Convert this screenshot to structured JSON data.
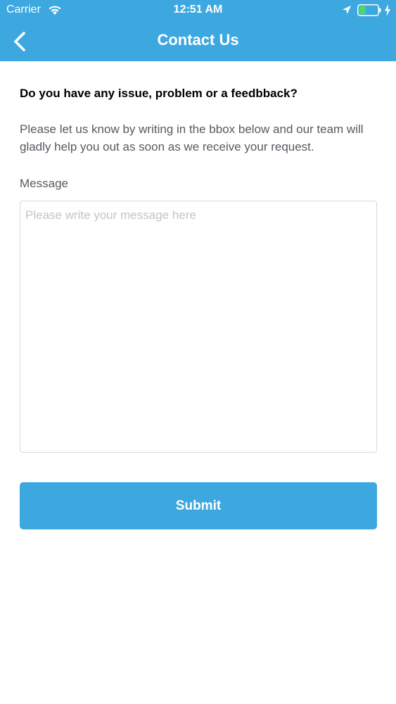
{
  "status_bar": {
    "carrier": "Carrier",
    "time": "12:51 AM",
    "icons": [
      "wifi-icon",
      "location-icon",
      "battery-icon",
      "charge-icon"
    ],
    "battery_color": "#4cd964"
  },
  "nav": {
    "title": "Contact Us",
    "back_icon": "chevron-left-icon"
  },
  "form": {
    "question": "Do you have any issue, problem or a feedbback?",
    "description": "Please let us know by writing in the bbox below and our team will gladly help you out as soon as we receive your request.",
    "message_label": "Message",
    "message_value": "",
    "message_placeholder": "Please write your message here",
    "submit_label": "Submit"
  },
  "colors": {
    "accent": "#3da8e0",
    "text_dark": "#000000",
    "text_secondary": "#555a60",
    "placeholder": "#c4c4ca",
    "border": "#d8d8dc"
  }
}
